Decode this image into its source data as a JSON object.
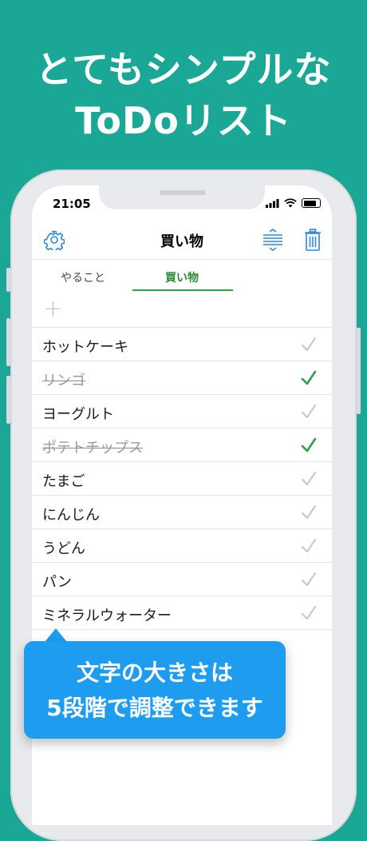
{
  "promo": {
    "headline_line1": "とてもシンプルな",
    "headline_line2": "ToDoリスト",
    "callout_line1": "文字の大きさは",
    "callout_line2": "5段階で調整できます"
  },
  "status_bar": {
    "time": "21:05"
  },
  "nav": {
    "title": "買い物"
  },
  "tabs": [
    {
      "label": "やること",
      "selected": false
    },
    {
      "label": "買い物",
      "selected": true
    }
  ],
  "add_row": {
    "icon": "plus-icon",
    "symbol": "+"
  },
  "items": [
    {
      "text": "ホットケーキ",
      "done": false
    },
    {
      "text": "リンゴ",
      "done": true
    },
    {
      "text": "ヨーグルト",
      "done": false
    },
    {
      "text": "ポテトチップス",
      "done": true
    },
    {
      "text": "たまご",
      "done": false
    },
    {
      "text": "にんじん",
      "done": false
    },
    {
      "text": "うどん",
      "done": false
    },
    {
      "text": "パン",
      "done": false
    },
    {
      "text": "ミネラルウォーター",
      "done": false
    }
  ],
  "colors": {
    "background": "#1aa795",
    "accent_blue": "#2f86e0",
    "check_done": "#2e9f4a",
    "check_undone": "#c4c4c4",
    "callout": "#1e9cef"
  }
}
